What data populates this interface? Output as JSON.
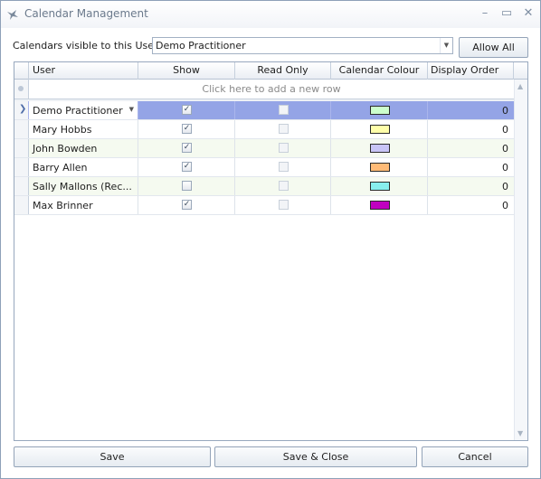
{
  "window": {
    "title": "Calendar Management",
    "icon": "hummingbird-icon",
    "controls": {
      "minimize": "–",
      "maximize": "▭",
      "close": "✕"
    }
  },
  "filter": {
    "label": "Calendars visible to this User...",
    "selected_user": "Demo Practitioner",
    "allow_all_label": "Allow All"
  },
  "grid": {
    "columns": [
      "User",
      "Show",
      "Read Only",
      "Calendar Colour",
      "Display Order"
    ],
    "add_row_text": "Click here to add a new row",
    "rows": [
      {
        "user": "Demo Practitioner",
        "show": true,
        "read_only": false,
        "colour": "#ccffcc",
        "order": "0",
        "selected": true
      },
      {
        "user": "Mary Hobbs",
        "show": true,
        "read_only": false,
        "colour": "#ffffaa",
        "order": "0",
        "selected": false
      },
      {
        "user": "John Bowden",
        "show": true,
        "read_only": false,
        "colour": "#c8c4f6",
        "order": "0",
        "selected": false
      },
      {
        "user": "Barry Allen",
        "show": true,
        "read_only": false,
        "colour": "#ffbb77",
        "order": "0",
        "selected": false
      },
      {
        "user": "Sally  Mallons (Rec...",
        "show": false,
        "read_only": false,
        "colour": "#88eeee",
        "order": "0",
        "selected": false
      },
      {
        "user": "Max Brinner",
        "show": true,
        "read_only": false,
        "colour": "#c000c0",
        "order": "0",
        "selected": false
      }
    ]
  },
  "buttons": {
    "save": "Save",
    "save_close": "Save & Close",
    "cancel": "Cancel"
  },
  "colors": {
    "selected_row": "#94a4e6",
    "alt_row": "#f5faf0",
    "header_bg": "#eaeef4"
  }
}
